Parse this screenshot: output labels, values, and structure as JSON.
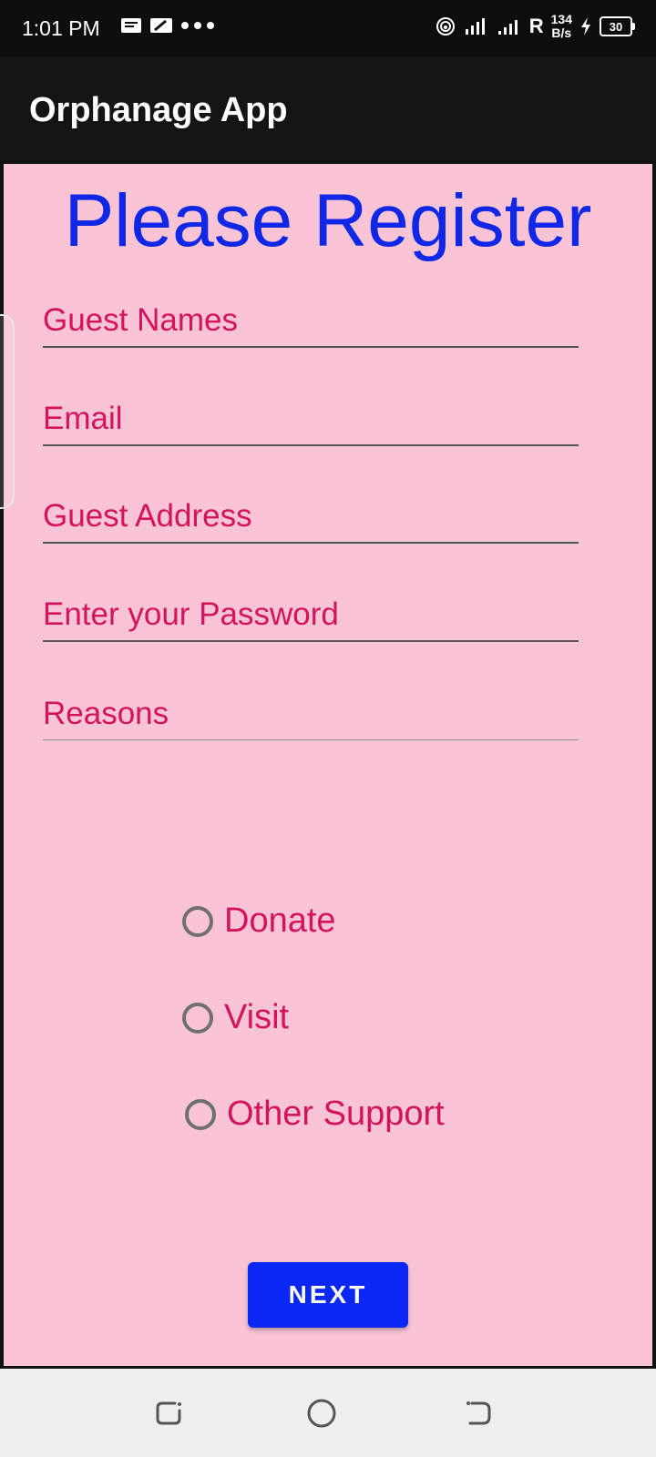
{
  "status_bar": {
    "time": "1:01 PM",
    "left_icons": [
      "message-icon",
      "sim-icon",
      "more-dots-icon"
    ],
    "network_type": "R",
    "speed_value": "134",
    "speed_unit": "B/s",
    "battery_level": "30"
  },
  "app_bar": {
    "title": "Orphanage App"
  },
  "form": {
    "heading": "Please Register",
    "fields": {
      "guest_names": {
        "placeholder": "Guest Names",
        "value": ""
      },
      "email": {
        "placeholder": "Email",
        "value": ""
      },
      "guest_address": {
        "placeholder": "Guest Address",
        "value": ""
      },
      "password": {
        "placeholder": "Enter your Password",
        "value": ""
      },
      "reasons": {
        "placeholder": "Reasons",
        "value": ""
      }
    },
    "radio_options": [
      "Donate",
      "Visit",
      "Other Support"
    ],
    "next_label": "NEXT"
  },
  "colors": {
    "background": "#f8c4d6",
    "heading": "#1028e6",
    "text_accent": "#d4135a",
    "button": "#0a28f5",
    "app_bar": "#141414"
  },
  "nav_bar": {
    "icons": [
      "recents-icon",
      "home-icon",
      "back-icon"
    ]
  }
}
